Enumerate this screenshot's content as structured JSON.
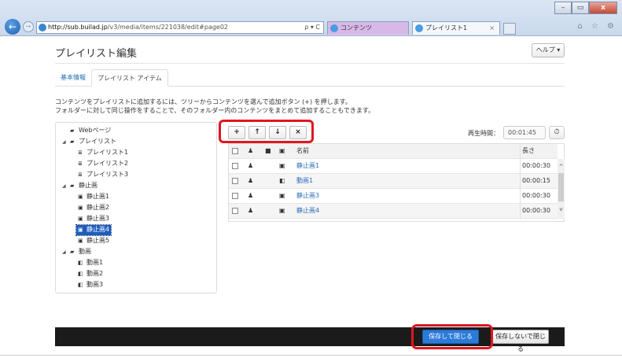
{
  "browser": {
    "url_domain": "http://sub.builad.jp",
    "url_path": "/v3/media/items/221038/edit#page02",
    "tabs": [
      {
        "label": "コンテンツ"
      },
      {
        "label": "プレイリスト1"
      }
    ],
    "tab_close": "×",
    "addr_tools": "ρ ▾ C",
    "right_icons": "⌂ ☆ ⚙",
    "win_controls": [
      "–",
      "▭",
      "x"
    ],
    "back": "←",
    "forward": "→"
  },
  "page": {
    "title": "プレイリスト編集",
    "help_label": "ヘルプ ▾",
    "tabs": [
      {
        "label": "基本情報"
      },
      {
        "label": "プレイリスト アイテム"
      }
    ],
    "description_line1": "コンテンツをプレイリストに追加するには、ツリーからコンテンツを選んで追加ボタン (+) を押します。",
    "description_line2": "フォルダーに対して同じ操作をすることで、そのフォルダー内のコンテンツをまとめて追加することもできます。"
  },
  "tree": {
    "nodes": [
      {
        "label": "Webページ",
        "icon": "folder-icon"
      },
      {
        "label": "プレイリスト",
        "icon": "folder-icon"
      },
      {
        "label": "プレイリスト1",
        "icon": "list-icon"
      },
      {
        "label": "プレイリスト2",
        "icon": "list-icon"
      },
      {
        "label": "プレイリスト3",
        "icon": "list-icon"
      },
      {
        "label": "静止画",
        "icon": "folder-icon"
      },
      {
        "label": "静止画1",
        "icon": "image-icon"
      },
      {
        "label": "静止画2",
        "icon": "image-icon"
      },
      {
        "label": "静止画3",
        "icon": "image-icon"
      },
      {
        "label": "静止画4",
        "icon": "image-icon",
        "selected": true
      },
      {
        "label": "静止画5",
        "icon": "image-icon"
      },
      {
        "label": "動画",
        "icon": "folder-icon"
      },
      {
        "label": "動画1",
        "icon": "film-icon"
      },
      {
        "label": "動画2",
        "icon": "film-icon"
      },
      {
        "label": "動画3",
        "icon": "film-icon"
      }
    ]
  },
  "toolbar": {
    "add": "+",
    "up": "↑",
    "down": "↓",
    "remove": "×",
    "play_time_label": "再生時間：",
    "play_time_value": "00:01:45",
    "clock": "⏱"
  },
  "table": {
    "header_name": "名前",
    "header_length": "長さ",
    "rows": [
      {
        "name": "静止画1",
        "length": "00:00:30",
        "type_icon": "image-icon"
      },
      {
        "name": "動画1",
        "length": "00:00:15",
        "type_icon": "film-icon"
      },
      {
        "name": "静止画3",
        "length": "00:00:30",
        "type_icon": "image-icon"
      },
      {
        "name": "静止画4",
        "length": "00:00:30",
        "type_icon": "image-icon"
      }
    ],
    "scroll_up": "^",
    "scroll_down": "v"
  },
  "footer": {
    "save_close": "保存して閉じる",
    "close_without_save": "保存しないで閉じる"
  },
  "colors": {
    "accent": "#2b7bd8",
    "highlight": "#e0161f",
    "footer_bg": "#1b1b1b",
    "selected_bg": "#1e5dbd"
  }
}
